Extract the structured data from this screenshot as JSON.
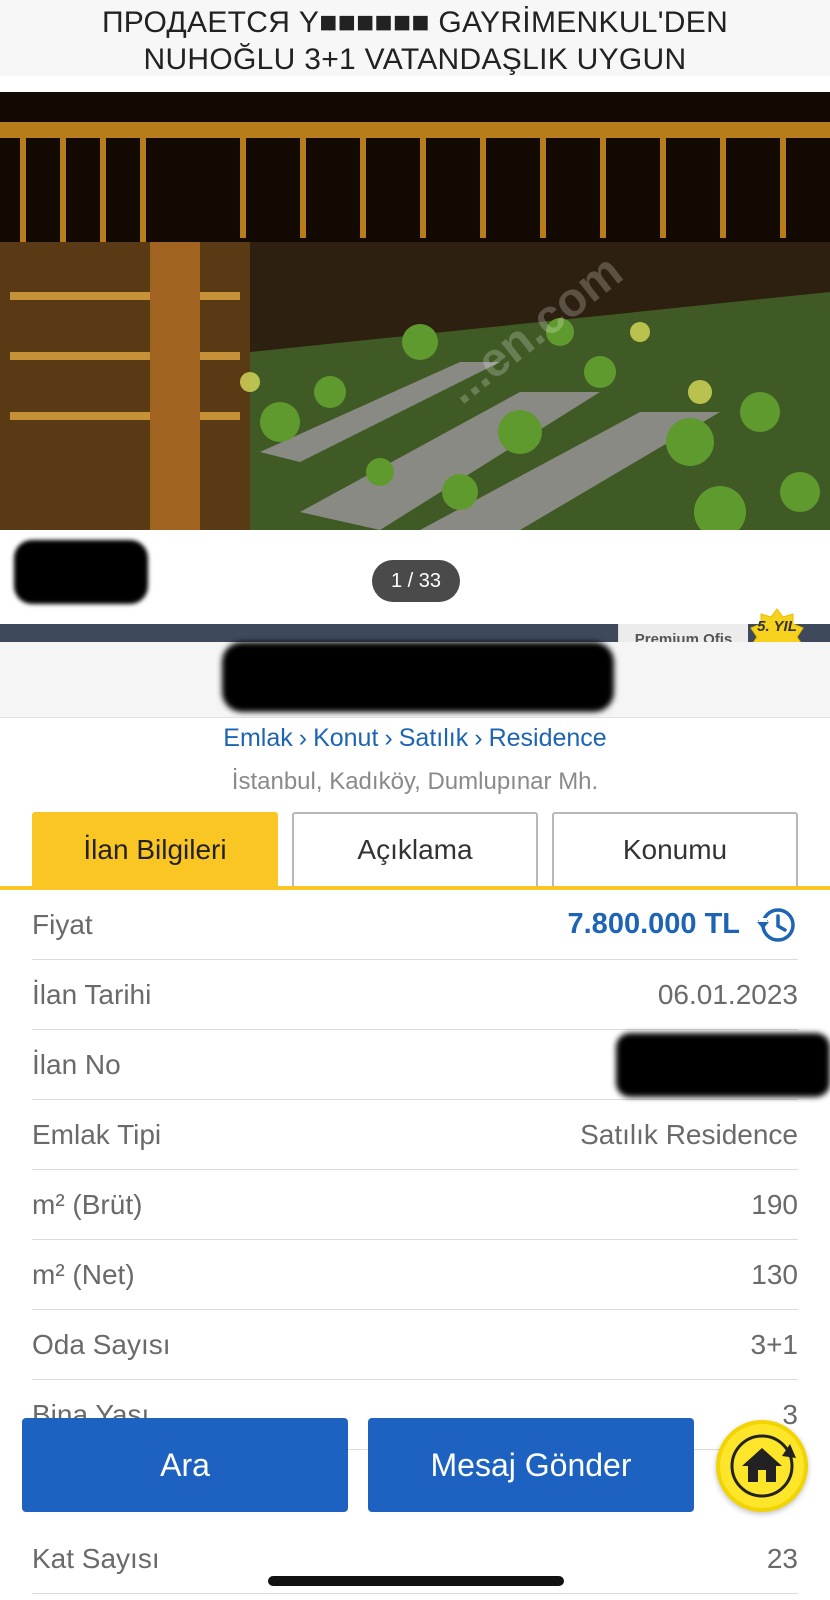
{
  "listing_title": {
    "line1": "ПРОДАЕТСЯ Y■■■■■■ GAYRİMENKUL'DEN",
    "line2": "NUHOĞLU 3+1 VATANDAŞLIK UYGUN"
  },
  "gallery": {
    "counter": "1 / 33",
    "watermark": "...en.com\nPE"
  },
  "store": {
    "premium_label": "Premium Ofis",
    "badge_text": "5. YIL"
  },
  "breadcrumb": {
    "items": [
      "Emlak",
      "Konut",
      "Satılık",
      "Residence"
    ],
    "separator": "›"
  },
  "location": "İstanbul, Kadıköy, Dumlupınar Mh.",
  "tabs": [
    {
      "label": "İlan Bilgileri",
      "active": true
    },
    {
      "label": "Açıklama",
      "active": false
    },
    {
      "label": "Konumu",
      "active": false
    }
  ],
  "details": {
    "price": {
      "label": "Fiyat",
      "value": "7.800.000 TL"
    },
    "date": {
      "label": "İlan Tarihi",
      "value": "06.01.2023"
    },
    "listing_no": {
      "label": "İlan No",
      "value": ""
    },
    "property_type": {
      "label": "Emlak Tipi",
      "value": "Satılık Residence"
    },
    "gross_area": {
      "label": "m² (Brüt)",
      "value": "190"
    },
    "net_area": {
      "label": "m² (Net)",
      "value": "130"
    },
    "rooms": {
      "label": "Oda Sayısı",
      "value": "3+1"
    },
    "building_age": {
      "label": "Bina Yaşı",
      "value": "3"
    },
    "floor_count": {
      "label": "Kat Sayısı",
      "value": "23"
    }
  },
  "actions": {
    "call_label": "Ara",
    "message_label": "Mesaj Gönder"
  },
  "colors": {
    "accent_yellow": "#f9c623",
    "primary_blue": "#1d62c0",
    "link_blue": "#1e64b4"
  }
}
